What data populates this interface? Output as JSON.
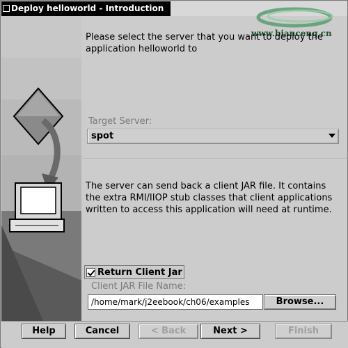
{
  "window": {
    "title": "Deploy helloworld - Introduction"
  },
  "watermark": {
    "text": "www.bianceng.cn"
  },
  "intro": {
    "text": "Please select the server that you want to deploy the application helloworld to"
  },
  "target_server": {
    "label": "Target Server:",
    "selected": "spot"
  },
  "client_jar": {
    "description": "The server can send back a client JAR file. It contains the extra RMI/IIOP stub classes that client applications written to access this application will need at runtime.",
    "return_checkbox_label": "Return Client Jar",
    "return_checked": true,
    "file_name_label": "Client JAR File Name:",
    "file_name_value": "/home/mark/j2eebook/ch06/examples",
    "browse_label": "Browse..."
  },
  "buttons": {
    "help": "Help",
    "cancel": "Cancel",
    "back": "< Back",
    "next": "Next >",
    "finish": "Finish"
  },
  "colors": {
    "titlebar": "#000000",
    "window_bg": "#cccccc",
    "sidepanel_accent": "#4a4a4a"
  }
}
